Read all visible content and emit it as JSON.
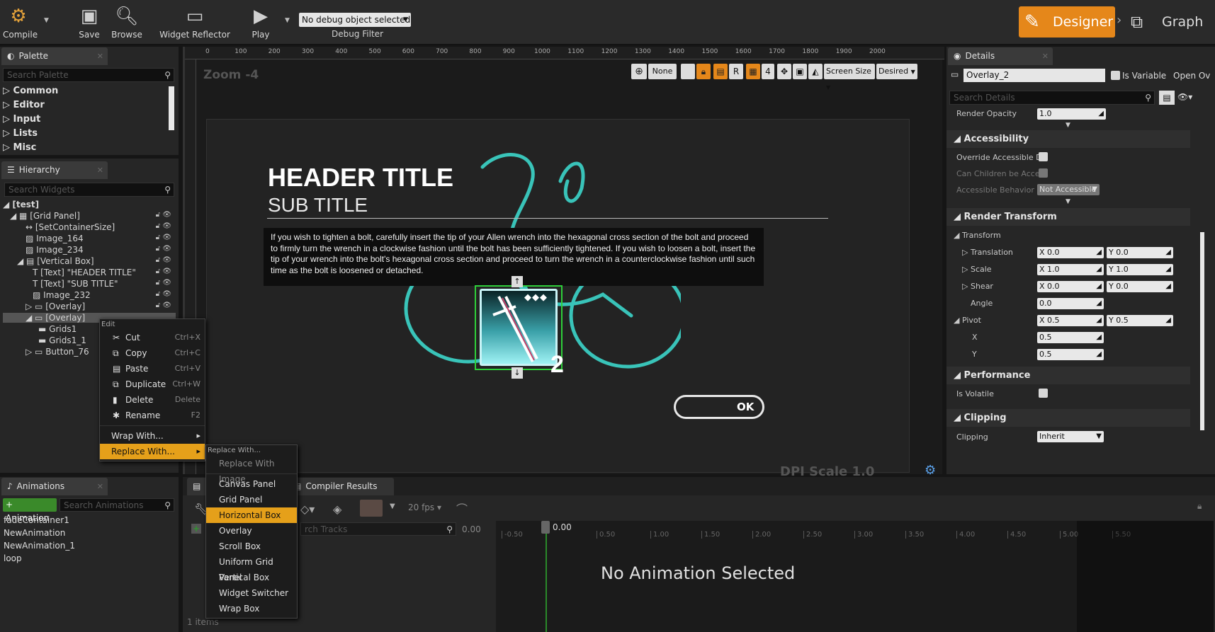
{
  "toolbar": {
    "compile": "Compile",
    "save": "Save",
    "browse": "Browse",
    "widget_reflector": "Widget Reflector",
    "play": "Play",
    "debug_select": "No debug object selected",
    "debug_filter": "Debug Filter",
    "designer": "Designer",
    "graph": "Graph"
  },
  "palette": {
    "tab": "Palette",
    "search_placeholder": "Search Palette",
    "items": [
      "Common",
      "Editor",
      "Input",
      "Lists",
      "Misc"
    ]
  },
  "hierarchy": {
    "tab": "Hierarchy",
    "search_placeholder": "Search Widgets",
    "root": "[test]",
    "items": [
      "[Grid Panel]",
      "[SetContainerSize]",
      "Image_164",
      "Image_234",
      "[Vertical Box]",
      "[Text] \"HEADER TITLE\"",
      "[Text] \"SUB TITLE\"",
      "Image_232",
      "[Overlay]",
      "[Overlay]",
      "Grids1",
      "Grids1_1",
      "Button_76"
    ]
  },
  "context_menu": {
    "section": "Edit",
    "items": [
      {
        "label": "Cut",
        "shortcut": "Ctrl+X"
      },
      {
        "label": "Copy",
        "shortcut": "Ctrl+C"
      },
      {
        "label": "Paste",
        "shortcut": "Ctrl+V"
      },
      {
        "label": "Duplicate",
        "shortcut": "Ctrl+W"
      },
      {
        "label": "Delete",
        "shortcut": "Delete"
      },
      {
        "label": "Rename",
        "shortcut": "F2"
      }
    ],
    "wrap": "Wrap With...",
    "replace": "Replace With..."
  },
  "submenu": {
    "header": "Replace With...",
    "first": "Replace With Image",
    "items": [
      "Canvas Panel",
      "Grid Panel",
      "Horizontal Box",
      "Overlay",
      "Scroll Box",
      "Uniform Grid Panel",
      "Vertical Box",
      "Widget Switcher",
      "Wrap Box"
    ],
    "highlighted": "Horizontal Box"
  },
  "canvas": {
    "zoom": "Zoom -4",
    "none": "None",
    "r": "R",
    "four": "4",
    "screen_size": "Screen Size",
    "desired": "Desired",
    "ruler": [
      "0",
      "100",
      "200",
      "300",
      "400",
      "500",
      "600",
      "700",
      "800",
      "900",
      "1000",
      "1100",
      "1200",
      "1300",
      "1400",
      "1500",
      "1600",
      "1700",
      "1800",
      "1900",
      "2000"
    ],
    "header_title": "HEADER TITLE",
    "sub_title": "SUB TITLE",
    "body": "If you wish to tighten a bolt, carefully insert the tip of your Allen wrench into the hexagonal cross section of the bolt and proceed to firmly turn the wrench in a clockwise fashion until the bolt has been sufficiently tightened. If you wish to loosen a bolt, insert the tip of your wrench into the bolt's hexagonal cross section and proceed to turn the wrench in a counterclockwise fashion until such time as the bolt is loosened or detached.",
    "count": "2",
    "ok": "OK",
    "dpi": "DPI Scale 1.0"
  },
  "details": {
    "tab": "Details",
    "name": "Overlay_2",
    "is_variable": "Is Variable",
    "open": "Open Ov",
    "search_placeholder": "Search Details",
    "render_opacity": "Render Opacity",
    "render_opacity_val": "1.0",
    "accessibility": "Accessibility",
    "override_acc": "Override Accessible D",
    "children_acc": "Can Children be Acces",
    "acc_behavior": "Accessible Behavior",
    "acc_behavior_val": "Not Accessible",
    "render_transform": "Render Transform",
    "transform": "Transform",
    "translation": "Translation",
    "scale": "Scale",
    "shear": "Shear",
    "angle": "Angle",
    "pivot": "Pivot",
    "x": "X",
    "y": "Y",
    "translation_x": "0.0",
    "translation_y": "0.0",
    "scale_x": "1.0",
    "scale_y": "1.0",
    "shear_x": "0.0",
    "shear_y": "0.0",
    "angle_val": "0.0",
    "pivot_x": "0.5",
    "pivot_y": "0.5",
    "px": "0.5",
    "py": "0.5",
    "performance": "Performance",
    "is_volatile": "Is Volatile",
    "clipping_hdr": "Clipping",
    "clipping": "Clipping",
    "clipping_val": "Inherit"
  },
  "animations": {
    "tab": "Animations",
    "add": "+ Animation",
    "search_placeholder": "Search Animations",
    "items": [
      "fadeContainer1",
      "NewAnimation",
      "NewAnimation_1",
      "loop"
    ]
  },
  "timeline": {
    "compiler_tab": "Compiler Results",
    "fps": "20 fps",
    "search_tracks": "rch Tracks",
    "time_val": "0.00",
    "cursor": "0.00",
    "ticks": [
      "-0.50",
      "0.50",
      "1.00",
      "1.50",
      "2.00",
      "2.50",
      "3.00",
      "3.50",
      "4.00",
      "4.50",
      "5.00",
      "5.50"
    ],
    "no_anim": "No Animation Selected",
    "items_count": "1 items"
  }
}
